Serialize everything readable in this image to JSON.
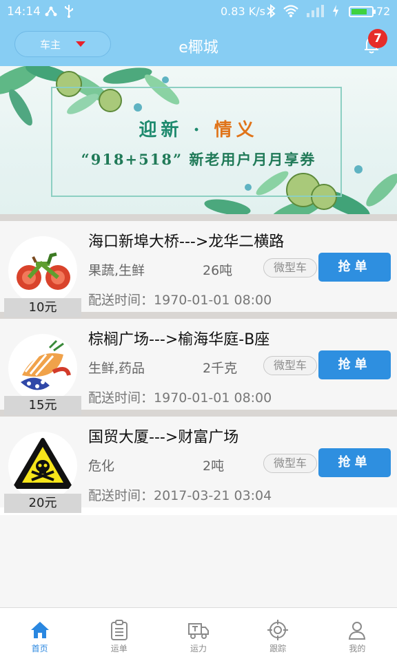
{
  "status_bar": {
    "time": "14:14",
    "speed": "0.83 K/s",
    "battery": "72",
    "battery_level": 0.72
  },
  "header": {
    "role": "车主",
    "title": "e椰城",
    "notification_count": "7"
  },
  "banner": {
    "headline_part1": "迎新",
    "headline_dot": "·",
    "headline_part2": "情义",
    "subline": "“918+518” 新老用户月月享券"
  },
  "orders": [
    {
      "route": "海口新埠大桥--->龙华二横路",
      "cargo": "果蔬,生鲜",
      "weight": "26吨",
      "vehicle": "微型车",
      "action": "抢单",
      "time_label": "配送时间：",
      "time": "1970-01-01 08:00",
      "price": "10元",
      "image": "veggie-bicycle"
    },
    {
      "route": "棕榈广场--->榆海华庭-B座",
      "cargo": "生鲜,药品",
      "weight": "2千克",
      "vehicle": "微型车",
      "action": "抢单",
      "time_label": "配送时间：",
      "time": "1970-01-01 08:00",
      "price": "15元",
      "image": "seafood-platter"
    },
    {
      "route": "国贸大厦--->财富广场",
      "cargo": "危化",
      "weight": "2吨",
      "vehicle": "微型车",
      "action": "抢单",
      "time_label": "配送时间：",
      "time": "2017-03-21 03:04",
      "price": "20元",
      "image": "toxic-warning-sign"
    }
  ],
  "tabs": [
    {
      "label": "首页",
      "icon": "home-icon",
      "active": true
    },
    {
      "label": "运单",
      "icon": "clipboard-icon",
      "active": false
    },
    {
      "label": "运力",
      "icon": "truck-icon",
      "active": false
    },
    {
      "label": "跟踪",
      "icon": "target-icon",
      "active": false
    },
    {
      "label": "我的",
      "icon": "user-icon",
      "active": false
    }
  ],
  "colors": {
    "header_bg": "#87cdf3",
    "accent": "#2e8fe0",
    "badge": "#e62d2a",
    "active_tab": "#2a87e0"
  }
}
